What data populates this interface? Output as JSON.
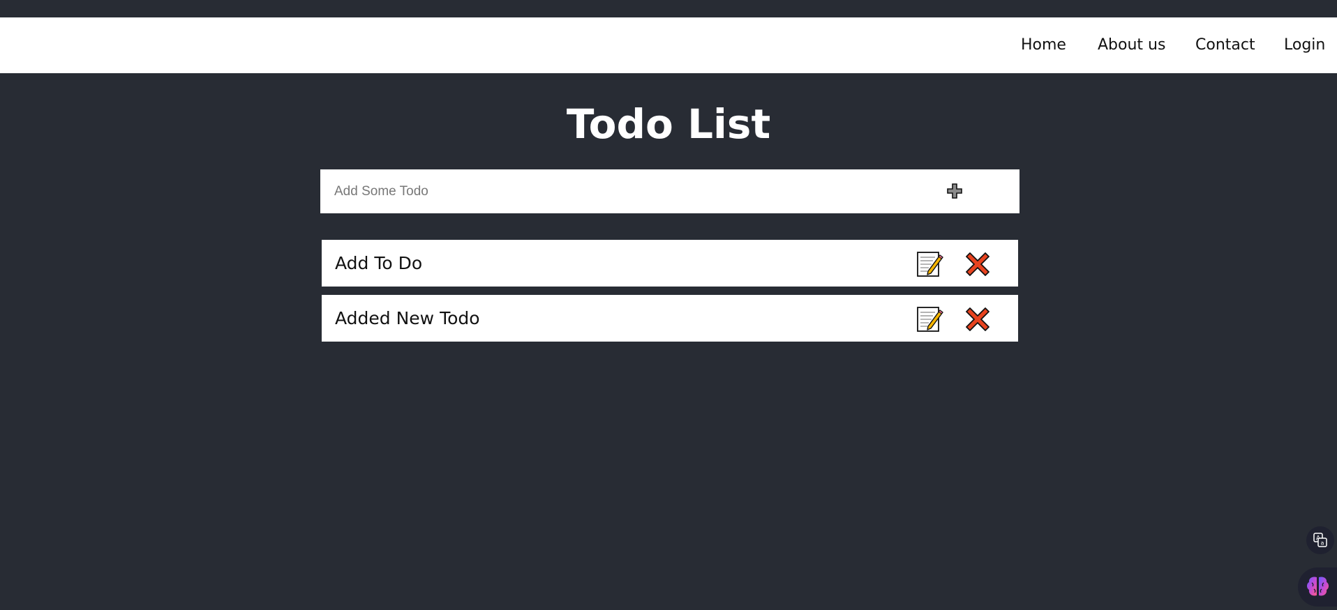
{
  "nav": {
    "links": [
      {
        "label": "Home"
      },
      {
        "label": "About us"
      },
      {
        "label": "Contact"
      },
      {
        "label": "Login"
      }
    ]
  },
  "page": {
    "title": "Todo List"
  },
  "add_form": {
    "placeholder": "Add Some Todo",
    "value": "",
    "add_icon": "plus-icon"
  },
  "todos": [
    {
      "text": "Add To Do",
      "edit_icon": "memo-pencil-icon",
      "delete_icon": "cross-mark-icon"
    },
    {
      "text": "Added New Todo",
      "edit_icon": "memo-pencil-icon",
      "delete_icon": "cross-mark-icon"
    }
  ],
  "floating": {
    "translate_icon": "translate-icon",
    "assistant_icon": "brain-icon"
  },
  "colors": {
    "background": "#282c34",
    "navbar": "#ffffff",
    "delete_red": "#e8431f",
    "pencil_yellow": "#f5b400"
  }
}
